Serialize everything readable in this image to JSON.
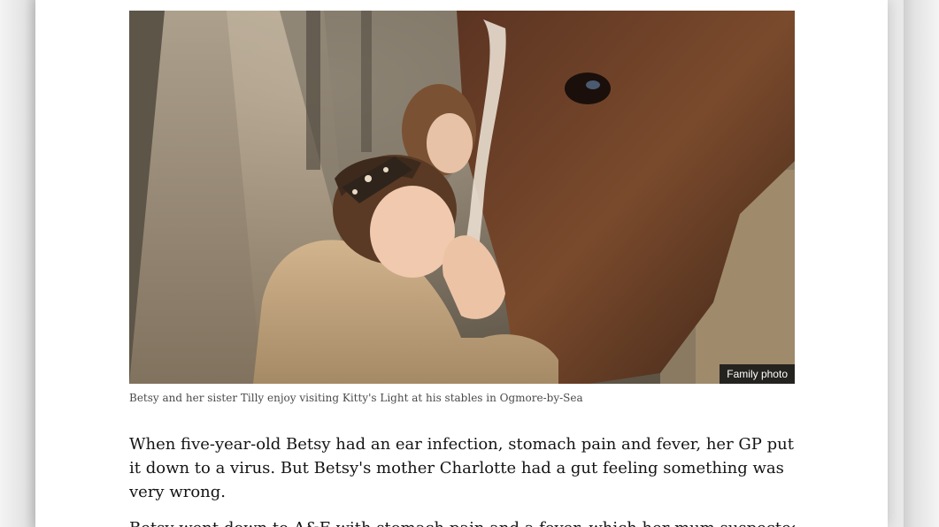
{
  "figure": {
    "image_description_icon": "photo-girl-hugging-horse-icon",
    "credit": "Family photo"
  },
  "caption": "Betsy and her sister Tilly enjoy visiting Kitty's Light at his stables in Ogmore-by-Sea",
  "paragraphs": [
    "When five-year-old Betsy had an ear infection, stomach pain and fever, her GP put it down to a virus. But Betsy's mother Charlotte had a gut feeling something was very wrong.",
    "Betsy went down to A&E with stomach pain and a fever, which her mum suspected"
  ]
}
